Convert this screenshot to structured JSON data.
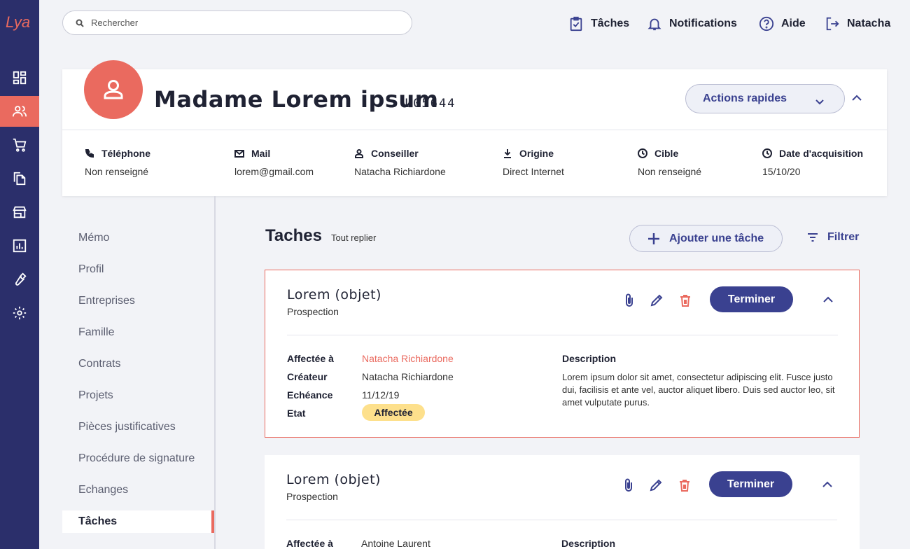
{
  "app": {
    "logo": "Lya",
    "accent": "#ea6a5f",
    "primary": "#3a4190",
    "rail_bg": "#2b2f6b"
  },
  "rail": {
    "items": [
      {
        "icon": "dashboard-icon"
      },
      {
        "icon": "users-icon",
        "active": true
      },
      {
        "icon": "cart-icon"
      },
      {
        "icon": "documents-icon"
      },
      {
        "icon": "store-icon"
      },
      {
        "icon": "chart-icon"
      },
      {
        "icon": "wrench-icon"
      },
      {
        "icon": "gear-icon"
      }
    ]
  },
  "search": {
    "placeholder": "Rechercher"
  },
  "topnav": {
    "tasks": "Tâches",
    "notifications": "Notifications",
    "help": "Aide",
    "user": "Natacha"
  },
  "client": {
    "name": "Madame Lorem ipsum",
    "id": "L05644",
    "actions_label": "Actions rapides",
    "info": {
      "phone_label": "Téléphone",
      "phone_value": "Non renseigné",
      "mail_label": "Mail",
      "mail_value": "lorem@gmail.com",
      "advisor_label": "Conseiller",
      "advisor_value": "Natacha Richiardone",
      "origin_label": "Origine",
      "origin_value": "Direct Internet",
      "target_label": "Cible",
      "target_value": "Non renseigné",
      "acq_label": "Date d'acquisition",
      "acq_value": "15/10/20"
    }
  },
  "side_menu": {
    "items": [
      "Mémo",
      "Profil",
      "Entreprises",
      "Famille",
      "Contrats",
      "Projets",
      "Pièces justificatives",
      "Procédure de signature",
      "Echanges",
      "Tâches"
    ],
    "active_index": 9
  },
  "tasks": {
    "title": "Taches",
    "collapse_all": "Tout replier",
    "add_label": "Ajouter une tâche",
    "filter_label": "Filtrer",
    "cards": [
      {
        "title": "Lorem (objet)",
        "type": "Prospection",
        "finish_label": "Terminer",
        "assigned_label": "Affectée à",
        "assigned_value": "Natacha Richiardone",
        "creator_label": "Créateur",
        "creator_value": "Natacha Richiardone",
        "due_label": "Echéance",
        "due_value": "11/12/19",
        "state_label": "Etat",
        "state_value": "Affectée",
        "desc_label": "Description",
        "desc_value": "Lorem ipsum dolor sit amet, consectetur adipiscing elit. Fusce justo dui, facilisis et ante vel, auctor aliquet libero. Duis sed auctor leo, sit amet vulputate purus."
      },
      {
        "title": "Lorem (objet)",
        "type": "Prospection",
        "finish_label": "Terminer",
        "assigned_label": "Affectée à",
        "assigned_value": "Antoine Laurent",
        "desc_label": "Description"
      }
    ]
  }
}
